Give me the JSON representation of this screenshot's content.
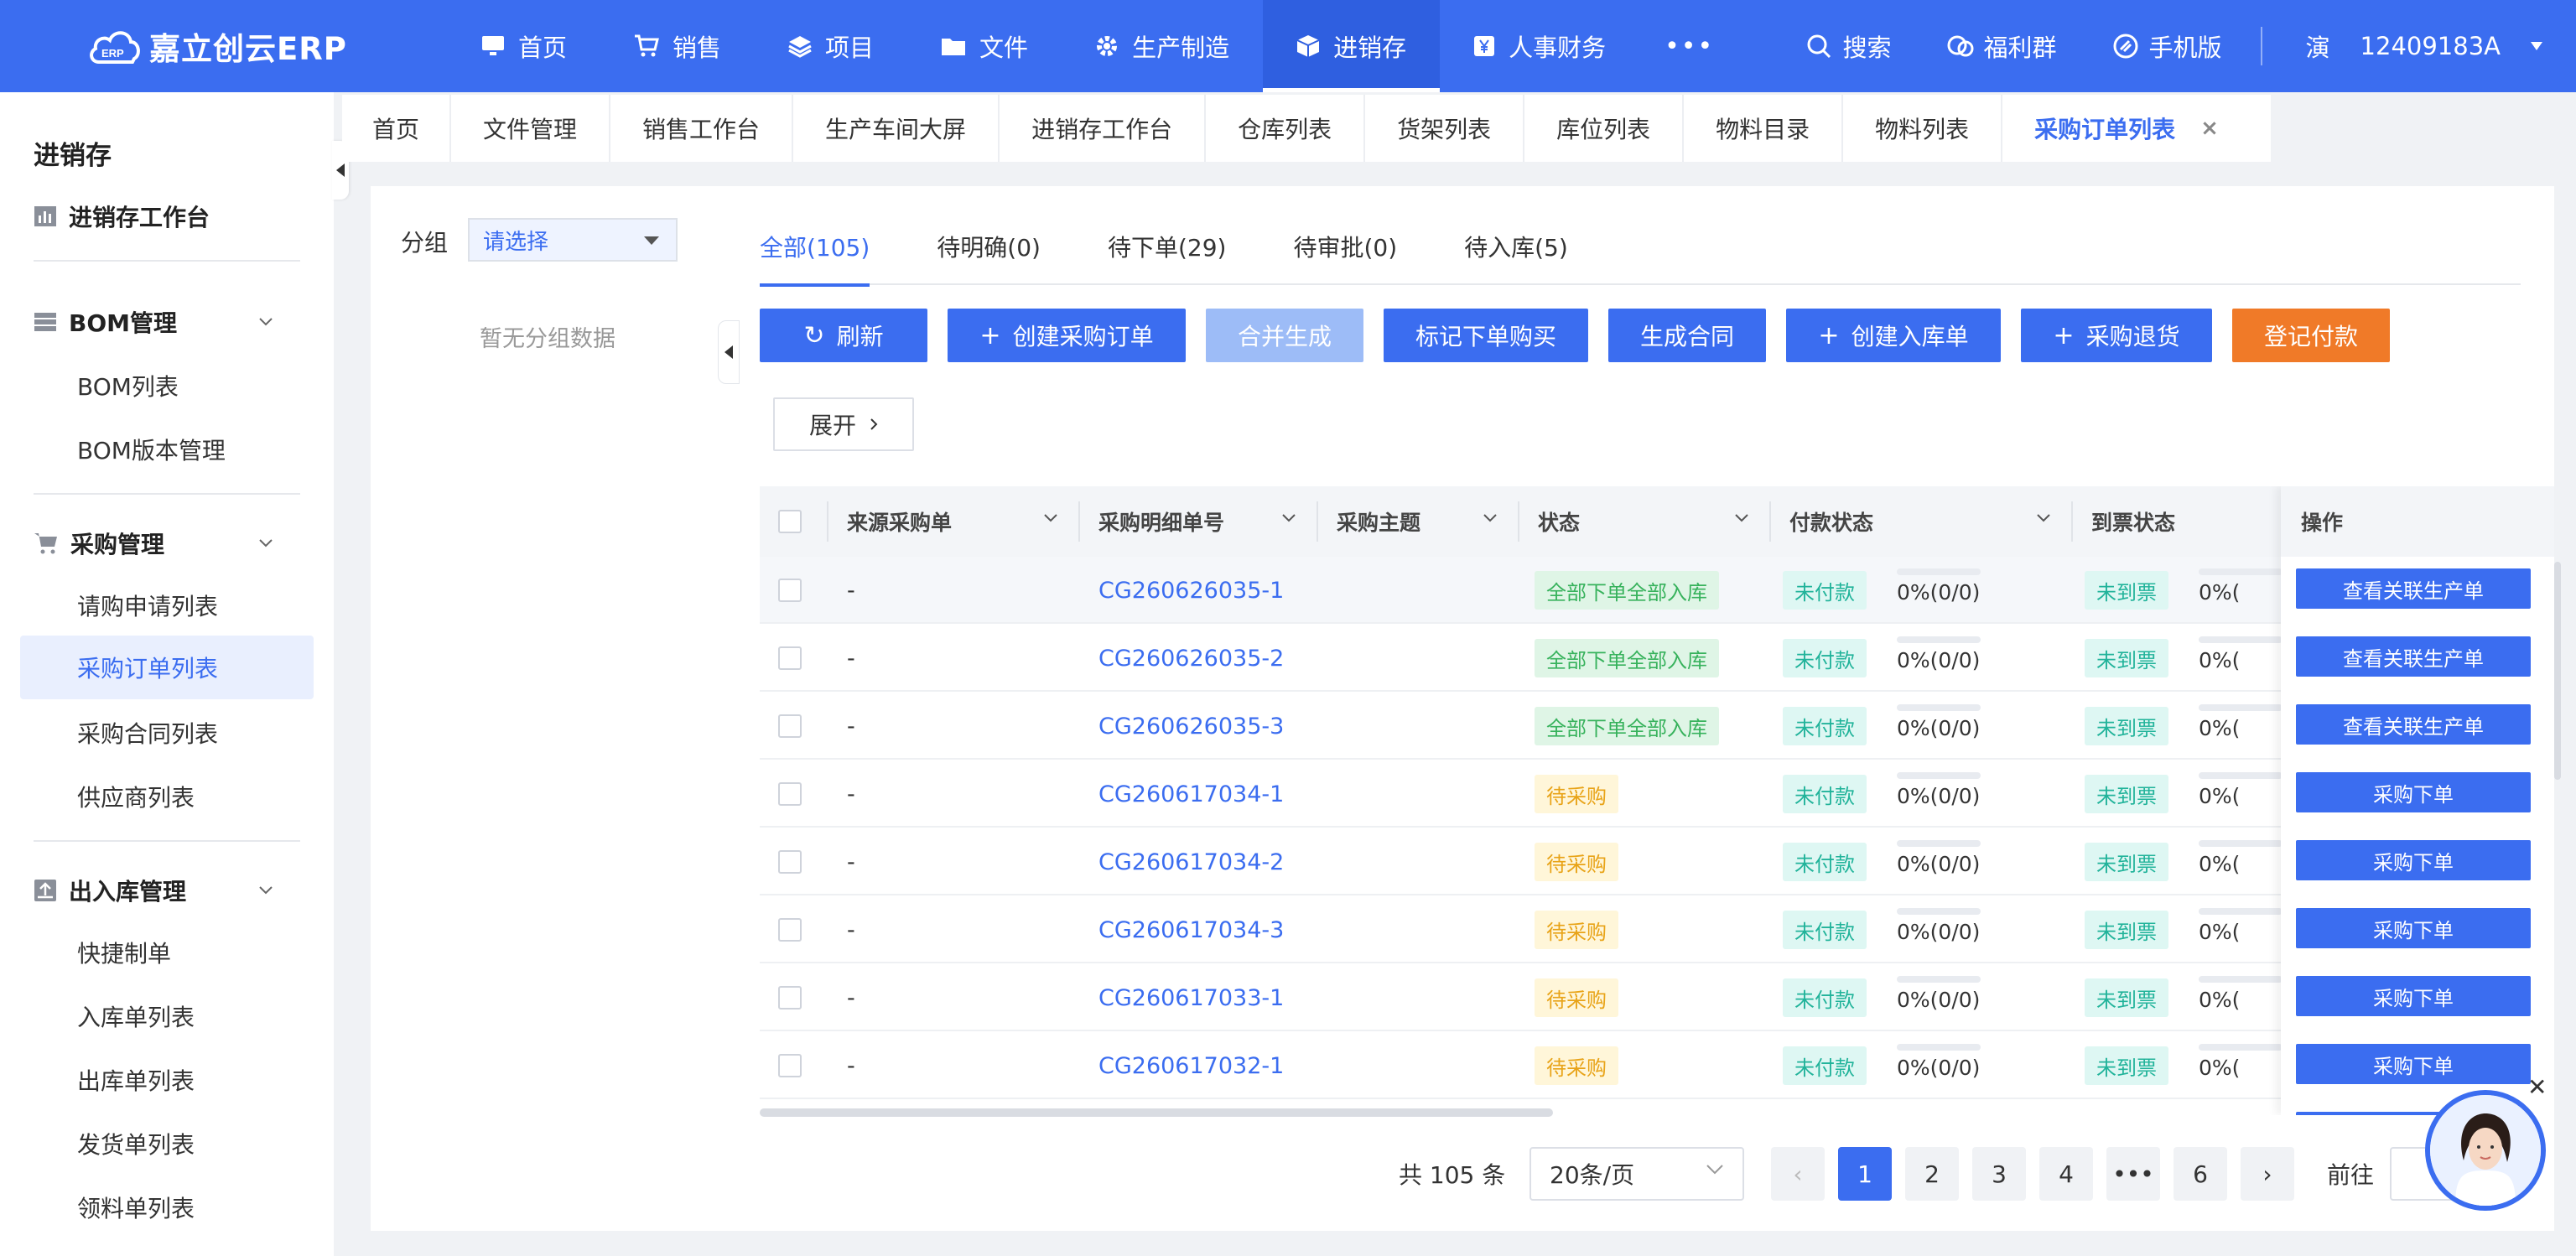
{
  "header": {
    "logo_text": "嘉立创云ERP",
    "logo_badge": "ERP",
    "nav": [
      {
        "label": "首页",
        "icon": "monitor-icon"
      },
      {
        "label": "销售",
        "icon": "cart-icon"
      },
      {
        "label": "项目",
        "icon": "layers-icon"
      },
      {
        "label": "文件",
        "icon": "folder-icon"
      },
      {
        "label": "生产制造",
        "icon": "gear-icon"
      },
      {
        "label": "进销存",
        "icon": "box-icon",
        "active": true
      },
      {
        "label": "人事财务",
        "icon": "yen-icon"
      }
    ],
    "more": "•••",
    "right": {
      "search": "搜索",
      "welfare": "福利群",
      "mobile": "手机版",
      "user_short": "演",
      "user_id": "12409183A"
    }
  },
  "sidebar": {
    "title": "进销存",
    "workbench": "进销存工作台",
    "sections": [
      {
        "label": "BOM管理",
        "items": [
          "BOM列表",
          "BOM版本管理"
        ]
      },
      {
        "label": "采购管理",
        "items": [
          "请购申请列表",
          "采购订单列表",
          "采购合同列表",
          "供应商列表"
        ],
        "active_item": "采购订单列表"
      },
      {
        "label": "出入库管理",
        "items": [
          "快捷制单",
          "入库单列表",
          "出库单列表",
          "发货单列表",
          "领料单列表"
        ]
      }
    ]
  },
  "tabs": [
    "首页",
    "文件管理",
    "销售工作台",
    "生产车间大屏",
    "进销存工作台",
    "仓库列表",
    "货架列表",
    "库位列表",
    "物料目录",
    "物料列表",
    "采购订单列表"
  ],
  "tab_close": "×",
  "group": {
    "label": "分组",
    "placeholder": "请选择",
    "empty": "暂无分组数据"
  },
  "status_tabs": [
    "全部(105)",
    "待明确(0)",
    "待下单(29)",
    "待审批(0)",
    "待入库(5)"
  ],
  "buttons": {
    "refresh": "刷新",
    "create_po": "创建采购订单",
    "merge": "合并生成",
    "mark_order": "标记下单购买",
    "gen_contract": "生成合同",
    "create_inbound": "创建入库单",
    "purchase_return": "采购退货",
    "register_pay": "登记付款",
    "expand": "展开"
  },
  "table": {
    "columns": [
      "来源采购单",
      "采购明细单号",
      "采购主题",
      "状态",
      "付款状态",
      "到票状态",
      "操作"
    ],
    "rows": [
      {
        "source": "-",
        "no": "CG260626035-1",
        "status": "全部下单全部入库",
        "status_type": "green",
        "pay": "未付款",
        "pay_pct": "0%(0/0)",
        "invoice": "未到票",
        "inv_pct": "0%(",
        "action": "查看关联生产单"
      },
      {
        "source": "-",
        "no": "CG260626035-2",
        "status": "全部下单全部入库",
        "status_type": "green",
        "pay": "未付款",
        "pay_pct": "0%(0/0)",
        "invoice": "未到票",
        "inv_pct": "0%(",
        "action": "查看关联生产单"
      },
      {
        "source": "-",
        "no": "CG260626035-3",
        "status": "全部下单全部入库",
        "status_type": "green",
        "pay": "未付款",
        "pay_pct": "0%(0/0)",
        "invoice": "未到票",
        "inv_pct": "0%(",
        "action": "查看关联生产单"
      },
      {
        "source": "-",
        "no": "CG260617034-1",
        "status": "待采购",
        "status_type": "yellow",
        "pay": "未付款",
        "pay_pct": "0%(0/0)",
        "invoice": "未到票",
        "inv_pct": "0%(",
        "action": "采购下单"
      },
      {
        "source": "-",
        "no": "CG260617034-2",
        "status": "待采购",
        "status_type": "yellow",
        "pay": "未付款",
        "pay_pct": "0%(0/0)",
        "invoice": "未到票",
        "inv_pct": "0%(",
        "action": "采购下单"
      },
      {
        "source": "-",
        "no": "CG260617034-3",
        "status": "待采购",
        "status_type": "yellow",
        "pay": "未付款",
        "pay_pct": "0%(0/0)",
        "invoice": "未到票",
        "inv_pct": "0%(",
        "action": "采购下单"
      },
      {
        "source": "-",
        "no": "CG260617033-1",
        "status": "待采购",
        "status_type": "yellow",
        "pay": "未付款",
        "pay_pct": "0%(0/0)",
        "invoice": "未到票",
        "inv_pct": "0%(",
        "action": "采购下单"
      },
      {
        "source": "-",
        "no": "CG260617032-1",
        "status": "待采购",
        "status_type": "yellow",
        "pay": "未付款",
        "pay_pct": "0%(0/0)",
        "invoice": "未到票",
        "inv_pct": "0%(",
        "action": "采购下单"
      }
    ]
  },
  "pagination": {
    "total": "共 105 条",
    "page_size": "20条/页",
    "prev": "‹",
    "next": "›",
    "pages": [
      "1",
      "2",
      "3",
      "4",
      "•••",
      "6"
    ],
    "current": "1",
    "goto": "前往"
  },
  "colors": {
    "primary": "#3b6df0",
    "orange": "#f07a28",
    "disabled": "#9dbcf7"
  }
}
